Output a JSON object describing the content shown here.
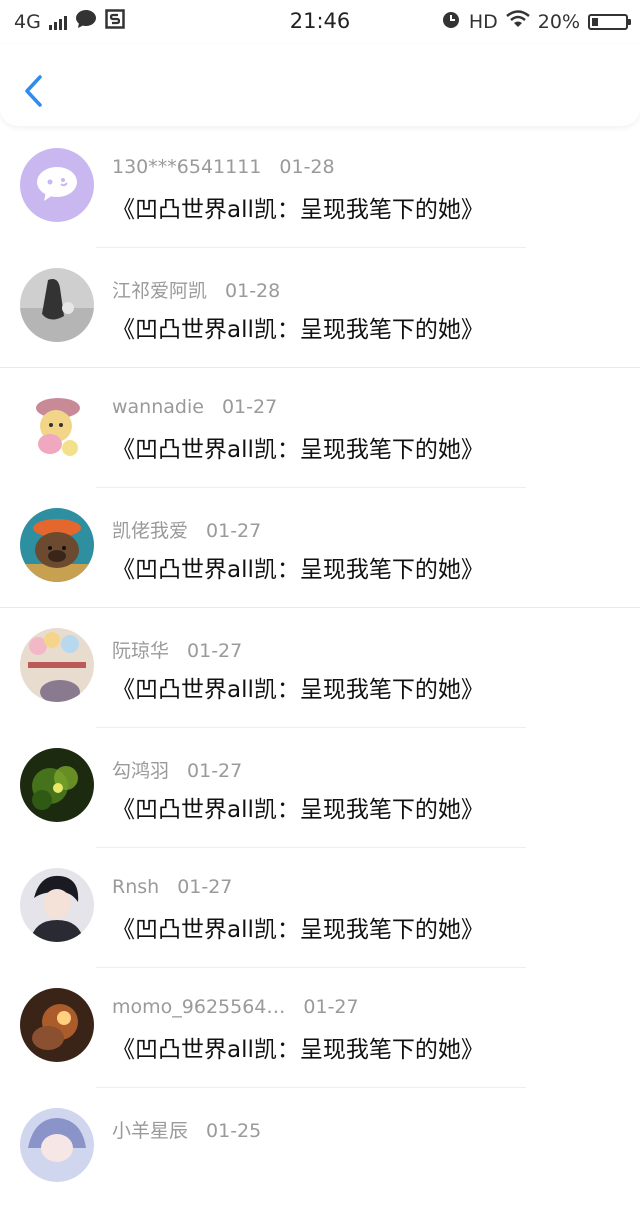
{
  "status_bar": {
    "network": "4G",
    "time": "21:46",
    "hd": "HD",
    "battery": "20%",
    "battery_level": 0.2
  },
  "header": {
    "back_icon": "chevron-left-icon",
    "accent_color": "#2e8cf0"
  },
  "items": [
    {
      "name": "130***6541111",
      "date": "01-28",
      "title": "《凹凸世界all凯：呈现我笔下的她》"
    },
    {
      "name": "江祁爱阿凯",
      "date": "01-28",
      "title": "《凹凸世界all凯：呈现我笔下的她》"
    },
    {
      "name": "wannadie",
      "date": "01-27",
      "title": "《凹凸世界all凯：呈现我笔下的她》"
    },
    {
      "name": "凯佬我爱",
      "date": "01-27",
      "title": "《凹凸世界all凯：呈现我笔下的她》"
    },
    {
      "name": "阮琼华",
      "date": "01-27",
      "title": "《凹凸世界all凯：呈现我笔下的她》"
    },
    {
      "name": "勾鸿羽",
      "date": "01-27",
      "title": "《凹凸世界all凯：呈现我笔下的她》"
    },
    {
      "name": "Rnsh",
      "date": "01-27",
      "title": "《凹凸世界all凯：呈现我笔下的她》"
    },
    {
      "name": "momo_9625564…",
      "date": "01-27",
      "title": "《凹凸世界all凯：呈现我笔下的她》"
    },
    {
      "name": "小羊星辰",
      "date": "01-25",
      "title": ""
    }
  ]
}
